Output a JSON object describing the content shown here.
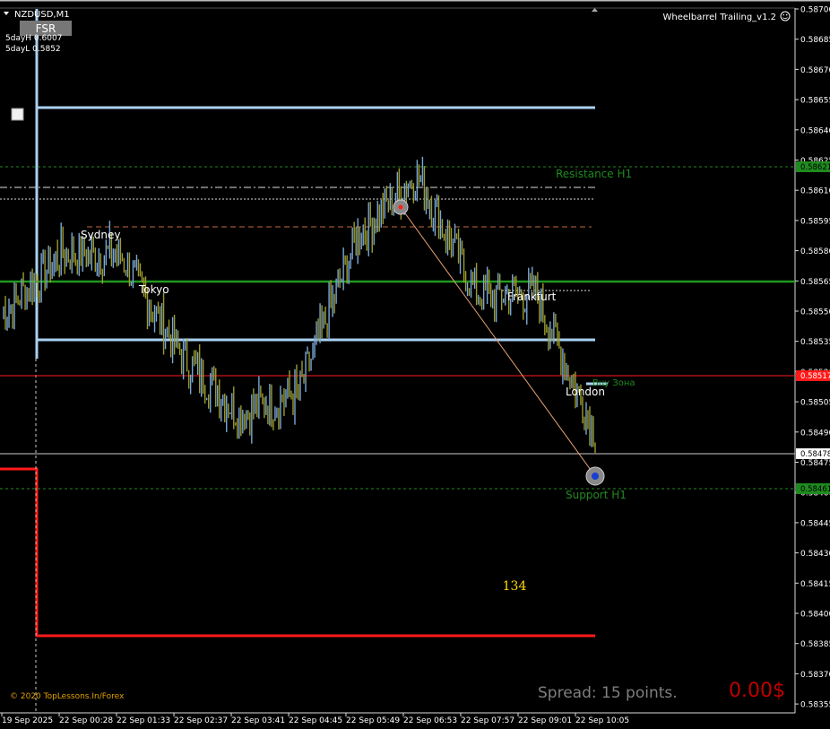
{
  "window": {
    "title": "NZDUSD,M1",
    "indicator_name": "Wheelbarrel Trailing_v1.2",
    "fsr_button": "FSR",
    "five_day_high": "5dayH 0.6007",
    "five_day_low": "5dayL 0.5852",
    "copyright": "© 2020 TopLessons.In/Forex"
  },
  "sessions": {
    "sydney": "Sydney",
    "tokyo": "Tokyo",
    "frankfurt": "Frankfurt",
    "london": "London"
  },
  "zones": {
    "resistance": "Resistance H1",
    "support": "Support H1",
    "buy_zone": "Buy Зона"
  },
  "status": {
    "spread": "Spread: 15 points.",
    "profit": "0.00$",
    "counter": "134"
  },
  "price_axis": {
    "ticks": [
      "0.58700",
      "0.58685",
      "0.58670",
      "0.58655",
      "0.58640",
      "0.58625",
      "0.58610",
      "0.58595",
      "0.58580",
      "0.58565",
      "0.58550",
      "0.58535",
      "0.58520",
      "0.58505",
      "0.58490",
      "0.58475",
      "0.58460",
      "0.58445",
      "0.58430",
      "0.58415",
      "0.58400",
      "0.58385",
      "0.58370",
      "0.58355"
    ],
    "resistance_marker": "0.58621",
    "red_marker": "0.58517",
    "bid_marker": "0.58478",
    "support_marker": "0.58461"
  },
  "time_axis": {
    "ticks": [
      "19 Sep 2025",
      "22 Sep 00:28",
      "22 Sep 01:33",
      "22 Sep 02:37",
      "22 Sep 03:41",
      "22 Sep 04:45",
      "22 Sep 05:49",
      "22 Sep 06:53",
      "22 Sep 07:57",
      "22 Sep 09:01",
      "22 Sep 10:05"
    ]
  },
  "colors": {
    "background": "#000000",
    "axis_text": "#ffffff",
    "price_up": "#7aa7d6",
    "price_down": "#9c9c2c",
    "light_blue_level": "#a9d0f0",
    "green_level": "#1f9a1f",
    "red_level": "#ff1a1a",
    "zone_text": "#1f8a1f",
    "counter": "#ffd700",
    "spread_text": "#7f7f7f",
    "profit_text": "#c00000",
    "copyright": "#e0a000"
  },
  "chart_data": {
    "type": "line",
    "x": [
      "19 Sep 2025",
      "22 Sep 00:28",
      "22 Sep 01:33",
      "22 Sep 02:37",
      "22 Sep 03:41",
      "22 Sep 04:45",
      "22 Sep 05:49",
      "22 Sep 06:53",
      "22 Sep 07:57",
      "22 Sep 09:01",
      "22 Sep 10:05"
    ],
    "ylim": [
      0.5835,
      0.587
    ],
    "series": [
      {
        "values": [
          0.5855,
          0.5858,
          0.5858,
          0.5853,
          0.585,
          0.5851,
          0.5859,
          0.5862,
          0.5856,
          0.5856,
          0.5849
        ]
      }
    ],
    "levels": [
      {
        "label": "Resistance H1",
        "value": 0.58621
      },
      {
        "label": "Support H1",
        "value": 0.58461
      },
      {
        "value": 0.58517
      },
      {
        "value": 0.58478
      },
      {
        "value": 0.58565
      },
      {
        "value": 0.58535
      },
      {
        "value": 0.58655
      },
      {
        "value": 0.58388
      }
    ],
    "grid": false
  }
}
